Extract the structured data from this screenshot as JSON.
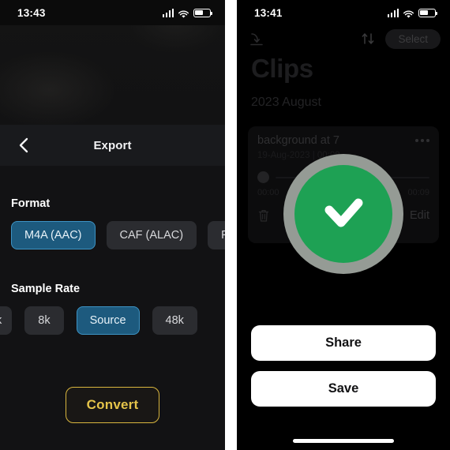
{
  "left_panel": {
    "status_bar": {
      "time": "13:43",
      "signal_icon": "cellular-bars-icon",
      "wifi_icon": "wifi-icon",
      "battery_icon": "battery-icon"
    },
    "sheet": {
      "back_icon": "chevron-left-icon",
      "title": "Export"
    },
    "format": {
      "label": "Format",
      "chips": [
        {
          "label": "M4A (AAC)",
          "selected": true
        },
        {
          "label": "CAF (ALAC)",
          "selected": false
        },
        {
          "label": "F",
          "selected": false
        }
      ]
    },
    "sample_rate": {
      "label": "Sample Rate",
      "chips": [
        {
          "label": "k",
          "selected": false
        },
        {
          "label": "8k",
          "selected": false
        },
        {
          "label": "Source",
          "selected": true
        },
        {
          "label": "48k",
          "selected": false
        }
      ]
    },
    "convert_button": "Convert"
  },
  "right_panel": {
    "status_bar": {
      "time": "13:41",
      "signal_icon": "cellular-bars-icon",
      "wifi_icon": "wifi-icon",
      "battery_icon": "battery-icon"
    },
    "toolbar": {
      "import_icon": "import-arrow-icon",
      "sort_icon": "sort-arrows-icon",
      "select_label": "Select"
    },
    "title": "Clips",
    "section_header": "2023 August",
    "clip": {
      "name": "background at 7",
      "subtitle": "19-Aug-2023 | 00:09",
      "more_icon": "more-dots-icon",
      "time_start": "00:00",
      "time_end": "00:09",
      "delete_icon": "trash-icon",
      "edit_label": "Edit"
    },
    "overlay": {
      "check_icon": "checkmark-icon",
      "ring_color": "#959b95",
      "circle_color": "#1ea154"
    },
    "actions": {
      "share_label": "Share",
      "save_label": "Save"
    },
    "home_indicator": "home-indicator"
  },
  "colors": {
    "accent_blue": "#1d5a7e",
    "accent_blue_border": "#3d93c4",
    "gold": "#e5c44a",
    "green": "#1ea154"
  }
}
